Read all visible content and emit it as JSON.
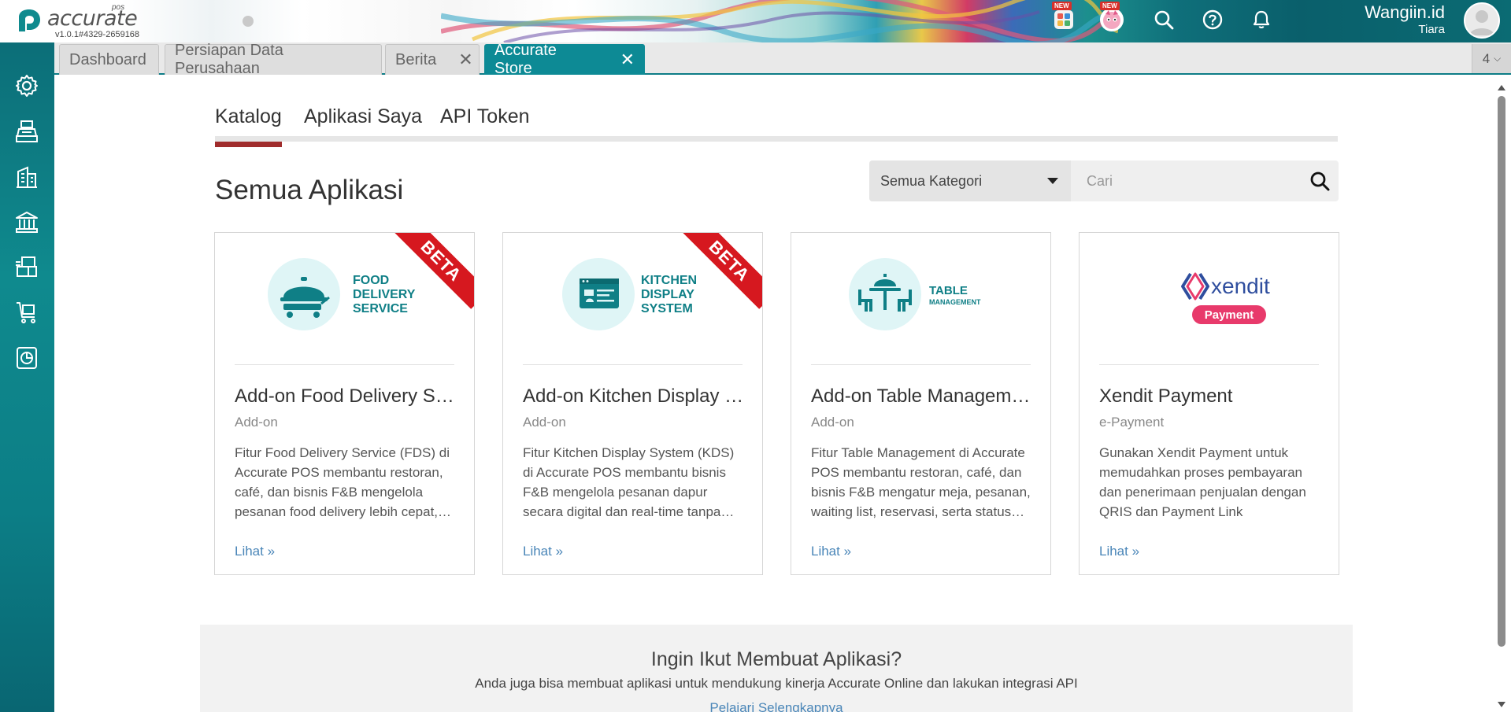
{
  "header": {
    "brand_name": "accurate",
    "brand_sup": "pos",
    "version": "v1.0.1#4329-2659168",
    "new_badge": "NEW",
    "user_name": "Wangiin.id",
    "user_role": "Tiara"
  },
  "tabs": [
    {
      "label": "Dashboard",
      "closable": false,
      "active": false
    },
    {
      "label": "Persiapan Data Perusahaan",
      "closable": false,
      "active": false
    },
    {
      "label": "Berita",
      "closable": true,
      "active": false
    },
    {
      "label": "Accurate Store",
      "closable": true,
      "active": true
    }
  ],
  "tab_count": "4",
  "sidebar": {
    "items": [
      {
        "icon": "gear-icon"
      },
      {
        "icon": "cashier-icon"
      },
      {
        "icon": "building-icon"
      },
      {
        "icon": "bank-icon"
      },
      {
        "icon": "inventory-icon"
      },
      {
        "icon": "cart-icon"
      },
      {
        "icon": "report-icon"
      }
    ]
  },
  "subnav": {
    "tabs": [
      "Katalog",
      "Aplikasi Saya",
      "API Token"
    ],
    "active": "Katalog"
  },
  "section_title": "Semua Aplikasi",
  "filter": {
    "category": "Semua Kategori",
    "search_placeholder": "Cari"
  },
  "cards": [
    {
      "logo_lines": [
        "FOOD",
        "DELIVERY",
        "SERVICE"
      ],
      "ribbon": "BETA",
      "title": "Add-on Food Delivery Service",
      "category": "Add-on",
      "description": "Fitur Food Delivery Service (FDS) di Accurate POS membantu restoran, café, dan bisnis F&B mengelola pesanan food delivery lebih cepat, lebih rapi, dan terintegrasi",
      "link": "Lihat »"
    },
    {
      "logo_lines": [
        "KITCHEN",
        "DISPLAY",
        "SYSTEM"
      ],
      "ribbon": "BETA",
      "title": "Add-on Kitchen Display System",
      "category": "Add-on",
      "description": "Fitur Kitchen Display System (KDS) di Accurate POS membantu bisnis F&B mengelola pesanan dapur secara digital dan real-time tanpa kertas",
      "link": "Lihat »"
    },
    {
      "logo_lines": [
        "TABLE",
        "MANAGEMENT"
      ],
      "ribbon": "",
      "title": "Add-on Table Management",
      "category": "Add-on",
      "description": "Fitur Table Management di Accurate POS membantu restoran, café, dan bisnis F&B mengatur meja, pesanan, waiting list, reservasi, serta status meja",
      "link": "Lihat »"
    },
    {
      "logo_word": "xendit",
      "logo_pill": "Payment",
      "ribbon": "",
      "title": "Xendit Payment",
      "category": "e-Payment",
      "description": "Gunakan Xendit Payment untuk memudahkan proses pembayaran dan penerimaan penjualan dengan QRIS dan Payment Link",
      "link": "Lihat »"
    }
  ],
  "cta": {
    "title": "Ingin Ikut Membuat Aplikasi?",
    "subtitle": "Anda juga bisa membuat aplikasi untuk mendukung kinerja Accurate Online dan lakukan integrasi API",
    "link": "Pelajari Selengkapnya"
  },
  "colors": {
    "teal": "#0d8a95",
    "sidebar": "#0f8a8e",
    "ribbon_red": "#d6181f",
    "active_underline": "#a02c2c",
    "link": "#4a86b8",
    "logo_teal": "#0f7f86",
    "logo_circle": "#dff5f6",
    "xendit_blue": "#2f4e9e",
    "xendit_pink": "#e83a6b"
  }
}
